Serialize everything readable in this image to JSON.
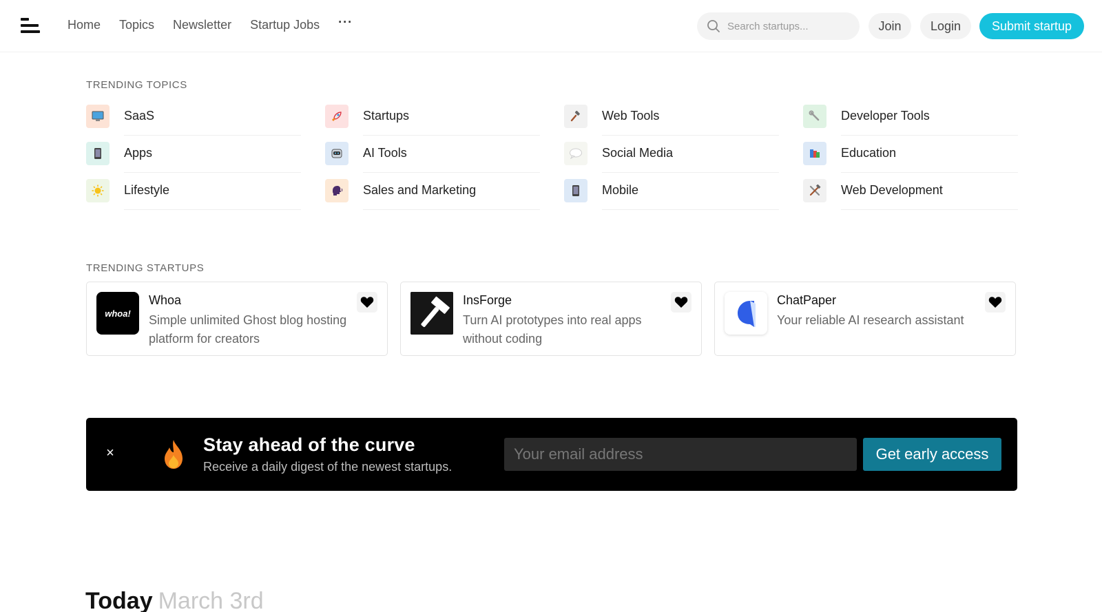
{
  "header": {
    "nav": [
      "Home",
      "Topics",
      "Newsletter",
      "Startup Jobs"
    ],
    "more_label": "···",
    "search_placeholder": "Search startups...",
    "join_label": "Join",
    "login_label": "Login",
    "submit_label": "Submit startup",
    "accent": "#16c1dd"
  },
  "trending_topics": {
    "heading": "TRENDING TOPICS",
    "items": [
      {
        "label": "SaaS",
        "icon": "computer-icon",
        "bg": "#fde3d6"
      },
      {
        "label": "Startups",
        "icon": "rocket-icon",
        "bg": "#fde1e1"
      },
      {
        "label": "Web Tools",
        "icon": "hammer-icon",
        "bg": "#f1f1f1"
      },
      {
        "label": "Developer Tools",
        "icon": "wrench-icon",
        "bg": "#dff3e3"
      },
      {
        "label": "Apps",
        "icon": "phone-icon",
        "bg": "#ddf3ee"
      },
      {
        "label": "AI Tools",
        "icon": "robot-icon",
        "bg": "#dde9f7"
      },
      {
        "label": "Social Media",
        "icon": "speech-bubble-icon",
        "bg": "#f5f6f1"
      },
      {
        "label": "Education",
        "icon": "books-icon",
        "bg": "#dde9f7"
      },
      {
        "label": "Lifestyle",
        "icon": "sun-icon",
        "bg": "#eef6e6"
      },
      {
        "label": "Sales and Marketing",
        "icon": "speaking-head-icon",
        "bg": "#fde9d6"
      },
      {
        "label": "Mobile",
        "icon": "mobile-icon",
        "bg": "#dde9f7"
      },
      {
        "label": "Web Development",
        "icon": "tools-icon",
        "bg": "#f1f1f1"
      }
    ]
  },
  "trending_startups": {
    "heading": "TRENDING STARTUPS",
    "cards": [
      {
        "name": "Whoa",
        "desc": "Simple unlimited Ghost blog hosting platform for creators",
        "logo_text": "whoa!",
        "logo_icon": "whoa-logo"
      },
      {
        "name": "InsForge",
        "desc": "Turn AI prototypes into real apps without coding",
        "logo_icon": "hammer-logo"
      },
      {
        "name": "ChatPaper",
        "desc": "Your reliable AI research assistant",
        "logo_icon": "chatpaper-logo"
      }
    ]
  },
  "newsletter": {
    "title": "Stay ahead of the curve",
    "subtitle": "Receive a daily digest of the newest startups.",
    "email_placeholder": "Your email address",
    "cta_label": "Get early access",
    "close_label": "×",
    "cta_color": "#127a93"
  },
  "today": {
    "label": "Today",
    "date": "March 3rd"
  }
}
